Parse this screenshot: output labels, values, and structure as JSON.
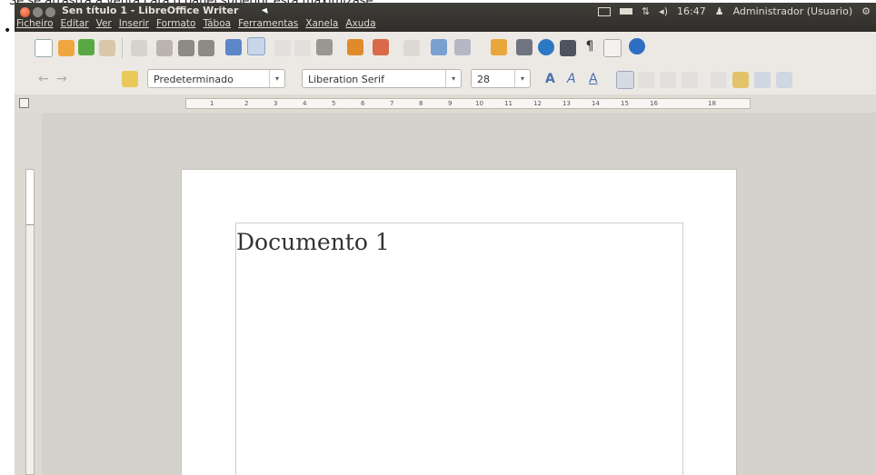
{
  "caption": "Se se arrastra a venta cara o panel superior esta maximízase...",
  "window": {
    "title": "Sen título 1 - LibreOffice Writer"
  },
  "menubar": [
    "Ficheiro",
    "Editar",
    "Ver",
    "Inserir",
    "Formato",
    "Táboa",
    "Ferramentas",
    "Xanela",
    "Axuda"
  ],
  "tray": {
    "time": "16:47",
    "user": "Administrador (Usuario)"
  },
  "formatting": {
    "paragraph_style": "Predeterminado",
    "font_name": "Liberation Serif",
    "font_size": "28"
  },
  "ruler": {
    "marks": [
      "1",
      "2",
      "3",
      "4",
      "5",
      "6",
      "7",
      "8",
      "9",
      "10",
      "11",
      "12",
      "13",
      "14",
      "15",
      "16",
      "18"
    ]
  },
  "document": {
    "text": "Documento 1"
  },
  "colors": {
    "close_button": "#e2461f",
    "panel": "#3a3935",
    "toolbar": "#ece9e5",
    "workspace": "#d5d1cb"
  }
}
